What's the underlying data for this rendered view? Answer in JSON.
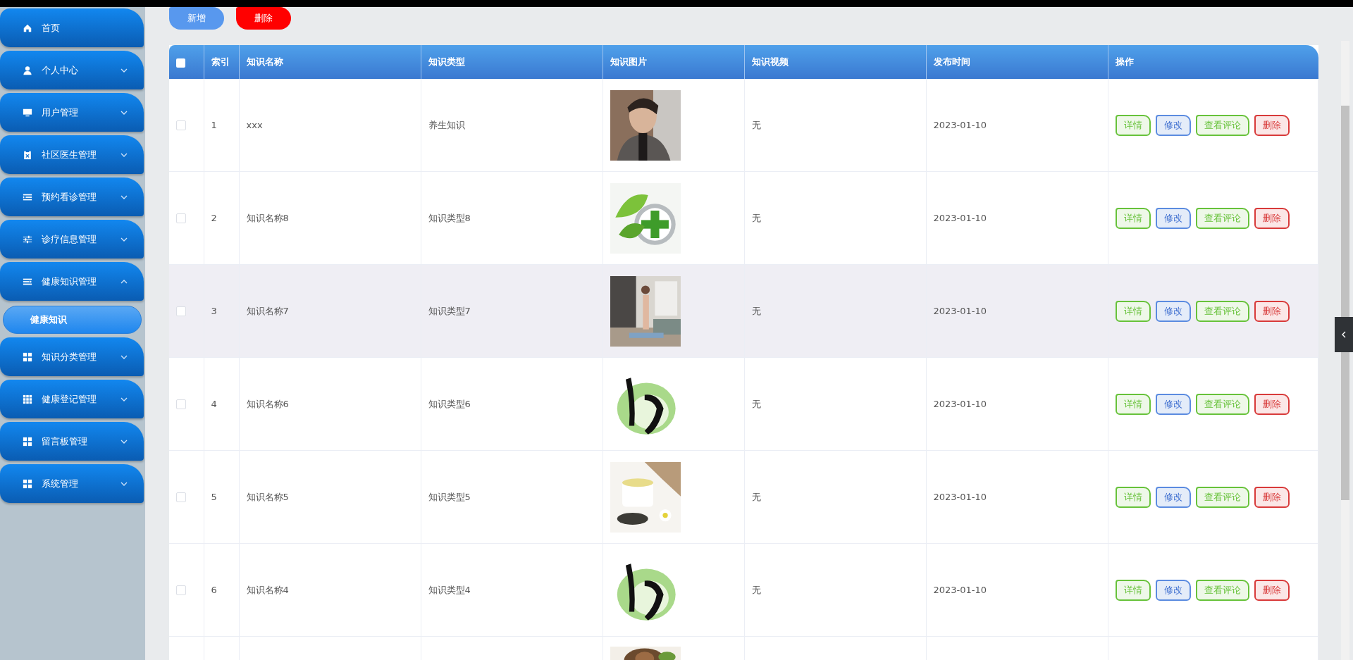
{
  "sidebar": {
    "items": [
      {
        "label": "首页"
      },
      {
        "label": "个人中心",
        "expanded": false
      },
      {
        "label": "用户管理",
        "expanded": false
      },
      {
        "label": "社区医生管理",
        "expanded": false
      },
      {
        "label": "预约看诊管理",
        "expanded": false
      },
      {
        "label": "诊疗信息管理",
        "expanded": false
      },
      {
        "label": "健康知识管理",
        "expanded": true,
        "children": [
          {
            "label": "健康知识",
            "selected": true
          }
        ]
      },
      {
        "label": "知识分类管理",
        "expanded": false
      },
      {
        "label": "健康登记管理",
        "expanded": false
      },
      {
        "label": "留言板管理",
        "expanded": false
      },
      {
        "label": "系统管理",
        "expanded": false
      }
    ]
  },
  "toolbar": {
    "buttons": [
      {
        "label": "新增",
        "kind": "primary"
      },
      {
        "label": "删除",
        "kind": "danger"
      }
    ]
  },
  "table": {
    "select_all": {
      "checked": false
    },
    "columns": [
      "索引",
      "知识名称",
      "知识类型",
      "知识图片",
      "知识视频",
      "发布时间",
      "操作"
    ],
    "rows": [
      {
        "checked": false,
        "highlighted": false,
        "index": "1",
        "name": "xxx",
        "type": "养生知识",
        "image": {
          "kind": "picture"
        },
        "video": "无",
        "time": "2023-01-10",
        "actions": [
          {
            "label": "详情",
            "kind": "detail"
          },
          {
            "label": "修改",
            "kind": "edit"
          },
          {
            "label": "查看评论",
            "kind": "comments"
          },
          {
            "label": "删除",
            "kind": "delete"
          }
        ]
      },
      {
        "checked": false,
        "highlighted": false,
        "index": "2",
        "name": "知识名称8",
        "type": "知识类型8",
        "image": {
          "kind": "picture"
        },
        "video": "无",
        "time": "2023-01-10",
        "actions": [
          {
            "label": "详情",
            "kind": "detail"
          },
          {
            "label": "修改",
            "kind": "edit"
          },
          {
            "label": "查看评论",
            "kind": "comments"
          },
          {
            "label": "删除",
            "kind": "delete"
          }
        ]
      },
      {
        "checked": false,
        "highlighted": true,
        "index": "3",
        "name": "知识名称7",
        "type": "知识类型7",
        "image": {
          "kind": "picture"
        },
        "video": "无",
        "time": "2023-01-10",
        "actions": [
          {
            "label": "详情",
            "kind": "detail"
          },
          {
            "label": "修改",
            "kind": "edit"
          },
          {
            "label": "查看评论",
            "kind": "comments"
          },
          {
            "label": "删除",
            "kind": "delete"
          }
        ]
      },
      {
        "checked": false,
        "highlighted": false,
        "index": "4",
        "name": "知识名称6",
        "type": "知识类型6",
        "image": {
          "kind": "picture"
        },
        "video": "无",
        "time": "2023-01-10",
        "actions": [
          {
            "label": "详情",
            "kind": "detail"
          },
          {
            "label": "修改",
            "kind": "edit"
          },
          {
            "label": "查看评论",
            "kind": "comments"
          },
          {
            "label": "删除",
            "kind": "delete"
          }
        ]
      },
      {
        "checked": false,
        "highlighted": false,
        "index": "5",
        "name": "知识名称5",
        "type": "知识类型5",
        "image": {
          "kind": "picture"
        },
        "video": "无",
        "time": "2023-01-10",
        "actions": [
          {
            "label": "详情",
            "kind": "detail"
          },
          {
            "label": "修改",
            "kind": "edit"
          },
          {
            "label": "查看评论",
            "kind": "comments"
          },
          {
            "label": "删除",
            "kind": "delete"
          }
        ]
      },
      {
        "checked": false,
        "highlighted": false,
        "index": "6",
        "name": "知识名称4",
        "type": "知识类型4",
        "image": {
          "kind": "picture"
        },
        "video": "无",
        "time": "2023-01-10",
        "actions": [
          {
            "label": "详情",
            "kind": "detail"
          },
          {
            "label": "修改",
            "kind": "edit"
          },
          {
            "label": "查看评论",
            "kind": "comments"
          },
          {
            "label": "删除",
            "kind": "delete"
          }
        ]
      },
      {
        "image": {
          "kind": "picture"
        }
      }
    ]
  }
}
